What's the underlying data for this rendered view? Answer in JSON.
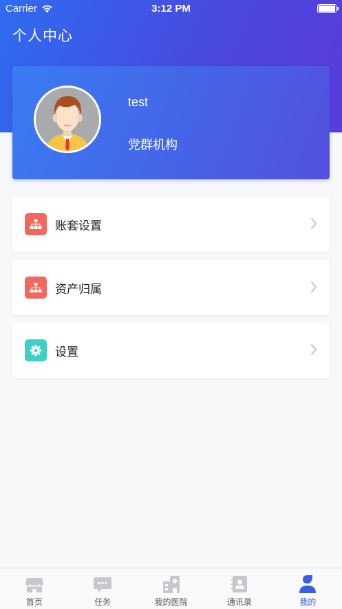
{
  "status_bar": {
    "carrier": "Carrier",
    "time": "3:12 PM"
  },
  "header": {
    "title": "个人中心"
  },
  "profile": {
    "username": "test",
    "organization": "党群机构"
  },
  "menu": [
    {
      "label": "账套设置",
      "icon": "org-chart-icon",
      "icon_color": "#f2685f"
    },
    {
      "label": "资产归属",
      "icon": "org-chart-icon",
      "icon_color": "#f2685f"
    },
    {
      "label": "设置",
      "icon": "gear-icon",
      "icon_color": "#3fcfc6"
    }
  ],
  "tabbar": {
    "items": [
      {
        "label": "首页",
        "icon": "storefront-icon"
      },
      {
        "label": "任务",
        "icon": "chat-bubble-icon"
      },
      {
        "label": "我的医院",
        "icon": "building-icon"
      },
      {
        "label": "通讯录",
        "icon": "contacts-icon"
      },
      {
        "label": "我的",
        "icon": "user-icon"
      }
    ],
    "active_index": 4,
    "active_color": "#3a5be4",
    "inactive_color": "#c5c8cf"
  }
}
